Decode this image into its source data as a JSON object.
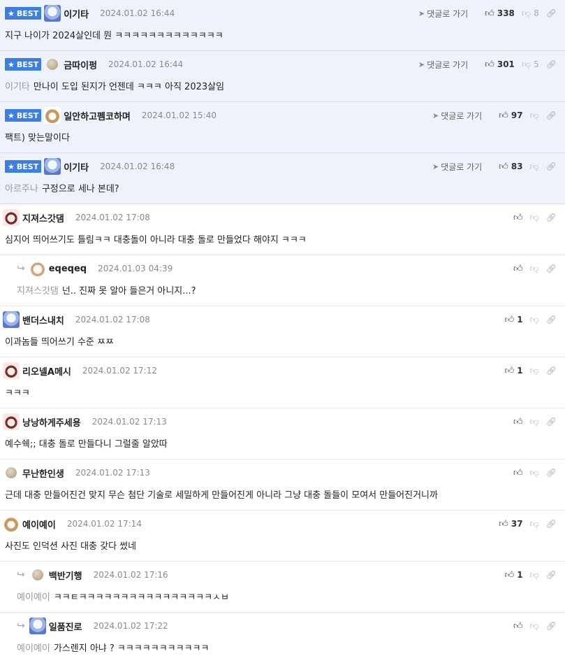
{
  "ui": {
    "best_label": "BEST",
    "goto_label": "댓글로 가기"
  },
  "comments": [
    {
      "best": true,
      "reply": false,
      "avatar": "white-dog",
      "author": "이기타",
      "date": "2024.01.02 16:44",
      "mention": "",
      "text": "지구 나이가 2024살인데 뭔 ㅋㅋㅋㅋㅋㅋㅋㅋㅋㅋㅋㅋㅋ",
      "likes": "338",
      "dislikes": "8"
    },
    {
      "best": true,
      "reply": false,
      "avatar": "beige-dot",
      "author": "금따이펑",
      "date": "2024.01.02 16:44",
      "mention": "이기타",
      "text": "만나이 도입 된지가 언젠데 ㅋㅋㅋ 아직 2023살임",
      "likes": "301",
      "dislikes": "5"
    },
    {
      "best": true,
      "reply": false,
      "avatar": "fox",
      "author": "일안하고펨코하며",
      "date": "2024.01.02 15:40",
      "mention": "",
      "text": "팩트) 맞는말이다",
      "likes": "97",
      "dislikes": ""
    },
    {
      "best": true,
      "reply": false,
      "avatar": "white-dog",
      "author": "이기타",
      "date": "2024.01.02 16:48",
      "mention": "아르주나",
      "text": "구정으로 세나 본데?",
      "likes": "83",
      "dislikes": ""
    },
    {
      "best": false,
      "reply": false,
      "avatar": "pig",
      "author": "지져스갓댐",
      "date": "2024.01.02 17:08",
      "mention": "",
      "text": "심지어 띄어쓰기도 틀림ㅋㅋ 대충돌이 아니라 대충 돌로 만들었다 해야지 ㅋㅋㅋ",
      "likes": "",
      "dislikes": ""
    },
    {
      "best": false,
      "reply": true,
      "avatar": "puppy",
      "author": "eqeqeq",
      "date": "2024.01.03 04:39",
      "mention": "지져스갓댐",
      "text": "넌.. 진짜 못 알아 들은거 아니지...?",
      "likes": "",
      "dislikes": ""
    },
    {
      "best": false,
      "reply": false,
      "avatar": "white-dog",
      "author": "밴더스내치",
      "date": "2024.01.02 17:08",
      "mention": "",
      "text": "이과놈들 띄어쓰기 수준 ㅉㅉ",
      "likes": "1",
      "dislikes": ""
    },
    {
      "best": false,
      "reply": false,
      "avatar": "pig",
      "author": "리오넬A메시",
      "date": "2024.01.02 17:12",
      "mention": "",
      "text": "ㅋㅋㅋ",
      "likes": "1",
      "dislikes": ""
    },
    {
      "best": false,
      "reply": false,
      "avatar": "pig",
      "author": "낭낭하게주세용",
      "date": "2024.01.02 17:13",
      "mention": "",
      "text": "예수쉑;; 대충 돌로 만들다니 그럴줄 알았따",
      "likes": "",
      "dislikes": ""
    },
    {
      "best": false,
      "reply": false,
      "avatar": "beige-dot",
      "author": "무난한인생",
      "date": "2024.01.02 17:13",
      "mention": "",
      "text": "근데 대충 만들어진건 맞지 무슨 첨단 기술로 세밀하게 만들어진게 아니라 그냥 대충 돌들이 모여서 만들어진거니까",
      "likes": "",
      "dislikes": ""
    },
    {
      "best": false,
      "reply": false,
      "avatar": "fox",
      "author": "예이예이",
      "date": "2024.01.02 17:14",
      "mention": "",
      "text": "사진도 인덕션 사진 대충 갖다 썼네",
      "likes": "37",
      "dislikes": ""
    },
    {
      "best": false,
      "reply": true,
      "avatar": "beige-dot",
      "author": "백반기행",
      "date": "2024.01.02 17:16",
      "mention": "예이예이",
      "text": "ㅋㅋㅌㅋㅋㅋㅋㅋㅋㅋㅋㅋㅋㅋㅋㅋㅋㅋㅋㅅㅂ",
      "likes": "1",
      "dislikes": ""
    },
    {
      "best": false,
      "reply": true,
      "avatar": "white-dog",
      "author": "일품진로",
      "date": "2024.01.02 17:22",
      "mention": "예이예이",
      "text": "가스렌지 아냐 ? ㅋㅋㅋㅋㅋㅋㅋㅋㅋㅋㅋ",
      "likes": "",
      "dislikes": ""
    }
  ]
}
